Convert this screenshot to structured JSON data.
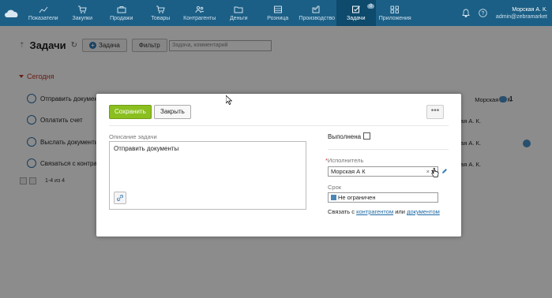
{
  "nav": {
    "items": [
      {
        "label": "Показатели",
        "icon": "chart-icon"
      },
      {
        "label": "Закупки",
        "icon": "cart-icon"
      },
      {
        "label": "Продажи",
        "icon": "briefcase-icon"
      },
      {
        "label": "Товары",
        "icon": "cart-icon"
      },
      {
        "label": "Контрагенты",
        "icon": "people-icon"
      },
      {
        "label": "Деньги",
        "icon": "folder-icon"
      },
      {
        "label": "Розница",
        "icon": "register-icon"
      },
      {
        "label": "Производство",
        "icon": "factory-icon"
      },
      {
        "label": "Задачи",
        "icon": "checkbox-icon",
        "active": true,
        "badge": "0"
      },
      {
        "label": "Приложения",
        "icon": "apps-icon"
      }
    ],
    "user_name": "Морская А. К.",
    "user_email": "admin@zebramarket"
  },
  "page": {
    "title": "Задачи",
    "add_task_label": "Задача",
    "filter_label": "Фильтр",
    "search_placeholder": "Задача, комментарий",
    "section_today": "Сегодня",
    "pager_text": "1-4 из 4"
  },
  "tasks": [
    {
      "title": "Отправить документ",
      "assignee": "Морская А. К.",
      "comments": "1"
    },
    {
      "title": "Оплатить счет",
      "assignee": "Морская А. К."
    },
    {
      "title": "Выслать документы",
      "assignee": "Морская А. К."
    },
    {
      "title": "Связаться с контраге",
      "assignee": "Морская А. К."
    }
  ],
  "modal": {
    "save_label": "Сохранить",
    "close_label": "Закрыть",
    "more_label": "•••",
    "description_label": "Описание задачи",
    "description_value": "Отправить документы",
    "done_label": "Выполнена",
    "assignee_label": "Исполнитель",
    "assignee_value": "Морская А  К",
    "due_label": "Срок",
    "due_value": "Не ограничен",
    "link_prefix": "Связать с ",
    "link_contractor": "контрагентом",
    "link_or": " или ",
    "link_document": "документом"
  }
}
